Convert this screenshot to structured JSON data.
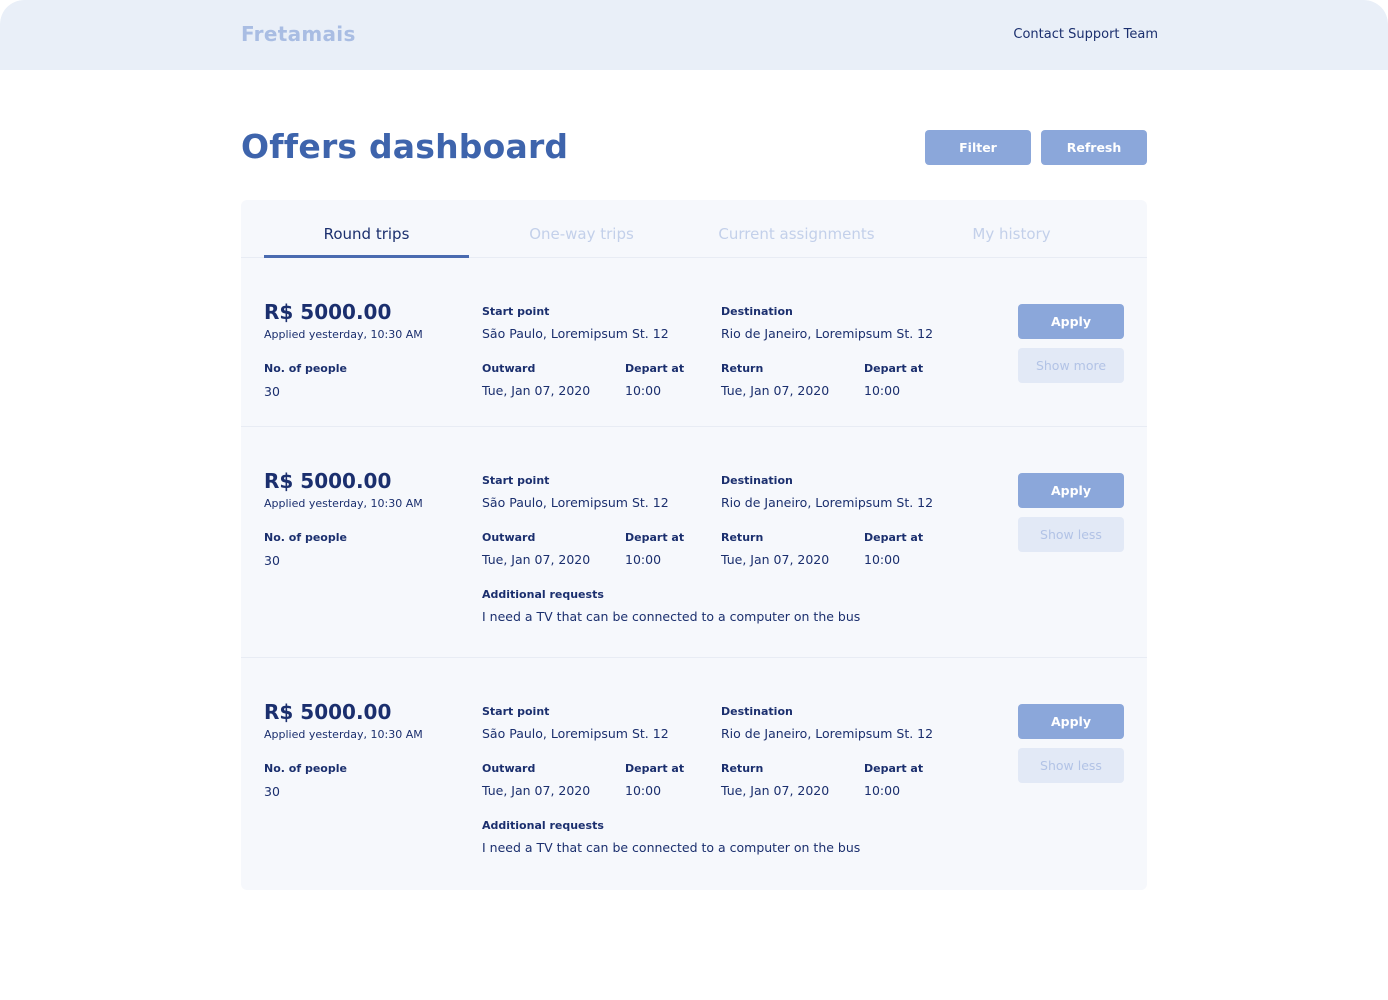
{
  "header": {
    "logo": "Fretamais",
    "support_link": "Contact Support Team"
  },
  "page": {
    "title": "Offers dashboard",
    "filter_label": "Filter",
    "refresh_label": "Refresh"
  },
  "tabs": [
    {
      "label": "Round trips",
      "active": true
    },
    {
      "label": "One-way trips",
      "active": false
    },
    {
      "label": "Current assignments",
      "active": false
    },
    {
      "label": "My history",
      "active": false
    }
  ],
  "labels": {
    "start_point": "Start point",
    "destination": "Destination",
    "no_of_people": "No. of people",
    "outward": "Outward",
    "depart_at": "Depart at",
    "return": "Return",
    "additional_requests": "Additional requests",
    "apply": "Apply"
  },
  "offers": [
    {
      "price": "R$ 5000.00",
      "applied": "Applied yesterday, 10:30 AM",
      "start_point": "São Paulo, Loremipsum St. 12",
      "destination": "Rio de Janeiro, Loremipsum St. 12",
      "people": "30",
      "outward_date": "Tue, Jan 07, 2020",
      "outward_time": "10:00",
      "return_date": "Tue, Jan 07, 2020",
      "return_time": "10:00",
      "toggle_label": "Show more"
    },
    {
      "price": "R$ 5000.00",
      "applied": "Applied yesterday, 10:30 AM",
      "start_point": "São Paulo, Loremipsum St. 12",
      "destination": "Rio de Janeiro, Loremipsum St. 12",
      "people": "30",
      "outward_date": "Tue, Jan 07, 2020",
      "outward_time": "10:00",
      "return_date": "Tue, Jan 07, 2020",
      "return_time": "10:00",
      "additional_requests": "I need a TV that can be connected to a computer on the bus",
      "toggle_label": "Show less"
    },
    {
      "price": "R$ 5000.00",
      "applied": "Applied yesterday, 10:30 AM",
      "start_point": "São Paulo, Loremipsum St. 12",
      "destination": "Rio de Janeiro, Loremipsum St. 12",
      "people": "30",
      "outward_date": "Tue, Jan 07, 2020",
      "outward_time": "10:00",
      "return_date": "Tue, Jan 07, 2020",
      "return_time": "10:00",
      "additional_requests": "I need a TV that can be connected to a computer on the bus",
      "toggle_label": "Show less"
    }
  ],
  "colors": {
    "accent": "#3e64ac",
    "button": "#8ba7da",
    "header_bg": "#e9eff8",
    "panel_bg": "#f6f8fc",
    "text": "#1b2f6e"
  }
}
